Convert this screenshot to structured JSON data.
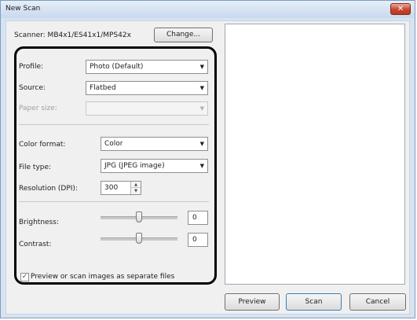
{
  "window": {
    "title": "New Scan",
    "close_label": "✕"
  },
  "scanner": {
    "label": "Scanner: MB4x1/ES41x1/MPS42x",
    "change_button": "Change..."
  },
  "profile": {
    "label": "Profile:",
    "value": "Photo (Default)"
  },
  "source": {
    "label": "Source:",
    "value": "Flatbed"
  },
  "paper_size": {
    "label": "Paper size:",
    "value": ""
  },
  "color_format": {
    "label": "Color format:",
    "value": "Color"
  },
  "file_type": {
    "label": "File type:",
    "value": "JPG (JPEG image)"
  },
  "resolution": {
    "label": "Resolution (DPI):",
    "value": "300"
  },
  "brightness": {
    "label": "Brightness:",
    "value": "0",
    "level": 0.5
  },
  "contrast": {
    "label": "Contrast:",
    "value": "0",
    "level": 0.5
  },
  "separate_files": {
    "label": "Preview or scan images as separate files",
    "checked": true
  },
  "buttons": {
    "preview": "Preview",
    "scan": "Scan",
    "cancel": "Cancel"
  },
  "icons": {
    "dropdown": "chevron-down-icon",
    "spin_up": "spin-up-icon",
    "spin_down": "spin-down-icon",
    "close": "close-icon",
    "check": "checkmark-icon"
  }
}
